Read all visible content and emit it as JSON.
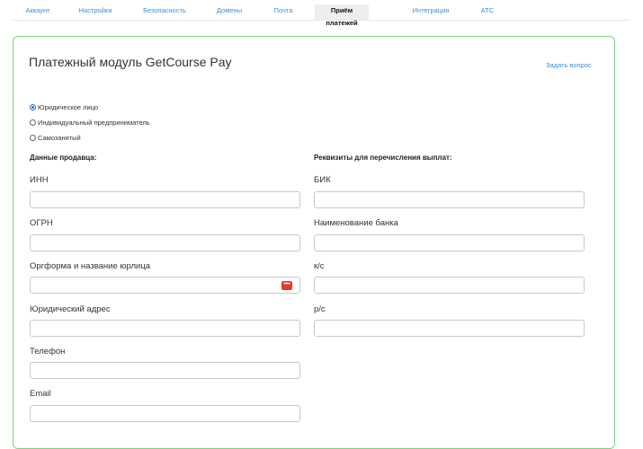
{
  "tabs": [
    {
      "label": "Аккаунт"
    },
    {
      "label": "Настройки"
    },
    {
      "label": "Безопасность"
    },
    {
      "label": "Домены"
    },
    {
      "label": "Почта"
    },
    {
      "label": "Приём платежей",
      "active": true
    },
    {
      "label": "Интеграция"
    },
    {
      "label": "АТС"
    }
  ],
  "page": {
    "title": "Платежный модуль GetCourse Pay",
    "ask_link": "Задать вопрос"
  },
  "entity_type": {
    "options": [
      "Юридическое лицо",
      "Индивидуальный предприниматель",
      "Самозанятый"
    ],
    "selected": "Юридическое лицо"
  },
  "seller": {
    "heading": "Данные продавца:",
    "fields": [
      {
        "label": "ИНН",
        "value": ""
      },
      {
        "label": "ОГРН",
        "value": ""
      },
      {
        "label": "Оргформа и название юрлица",
        "value": ""
      },
      {
        "label": "Юридический адрес",
        "value": ""
      },
      {
        "label": "Телефон",
        "value": ""
      },
      {
        "label": "Email",
        "value": ""
      }
    ]
  },
  "payout": {
    "heading": "Реквизиты для перечисления выплат:",
    "fields": [
      {
        "label": "БИК",
        "value": ""
      },
      {
        "label": "Наименование банка",
        "value": ""
      },
      {
        "label": "к/с",
        "value": ""
      },
      {
        "label": "р/с",
        "value": ""
      }
    ]
  },
  "colors": {
    "accent": "#3d8fd6",
    "panel_border": "#7cd27e",
    "field_icon": "#e53935"
  },
  "icons": {
    "field_icon": "more-dots-icon"
  }
}
